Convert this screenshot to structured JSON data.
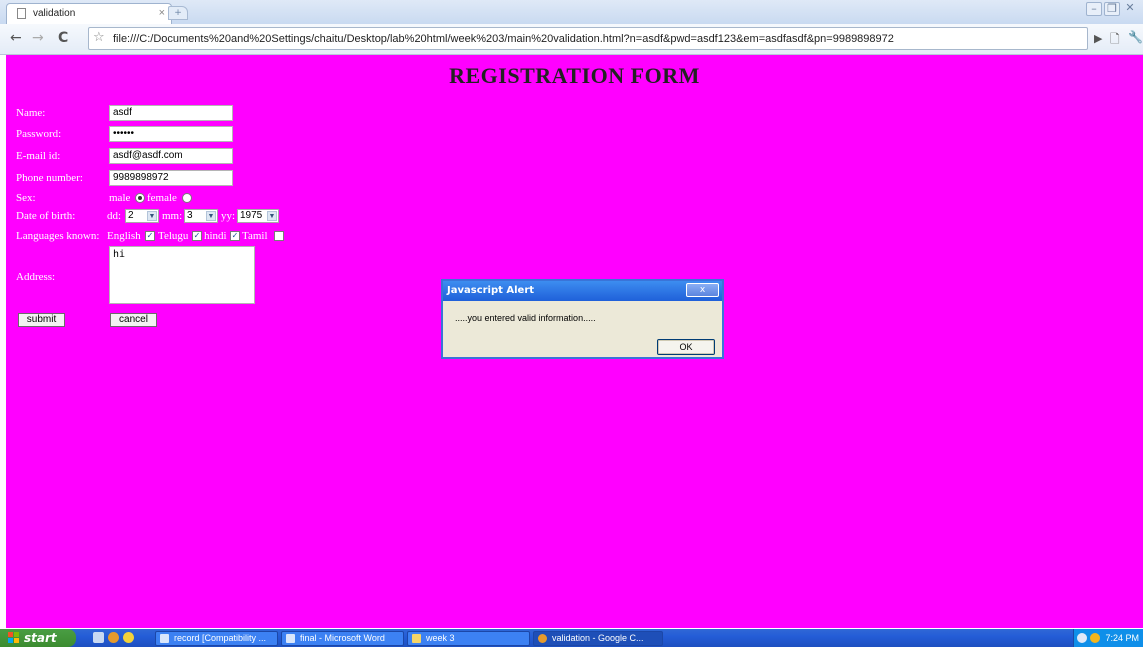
{
  "browser": {
    "tab_title": "validation",
    "tab_close": "×",
    "url": "file:///C:/Documents%20and%20Settings/chaitu/Desktop/lab%20html/week%203/main%20validation.html?n=asdf&pwd=asdf123&em=asdfasdf&pn=9989898972",
    "icons": {
      "back": "back-arrow-icon",
      "forward": "forward-arrow-icon",
      "reload": "reload-icon",
      "star": "star-icon",
      "page": "page-menu-icon",
      "wrench": "wrench-icon"
    }
  },
  "form": {
    "heading": "REGISTRATION FORM",
    "name_label": "Name:",
    "name_value": "asdf",
    "password_label": "Password:",
    "password_value": "••••••",
    "email_label": "E-mail id:",
    "email_value": "asdf@asdf.com",
    "phone_label": "Phone number:",
    "phone_value": "9989898972",
    "sex_label": "Sex:",
    "sex_male": "male",
    "sex_female": "female",
    "dob_label": "Date of birth:",
    "dd_label": "dd:",
    "dd_value": "2",
    "mm_label": "mm:",
    "mm_value": "3",
    "yy_label": "yy:",
    "yy_value": "1975",
    "lang_label": "Languages known:",
    "lang_english": "English",
    "lang_telugu": "Telugu",
    "lang_hindi": "hindi",
    "lang_tamil": "Tamil",
    "address_label": "Address:",
    "address_value": "hi",
    "submit_label": "submit",
    "cancel_label": "cancel"
  },
  "alert": {
    "title": "Javascript Alert",
    "close": "x",
    "message": ".....you entered valid information.....",
    "ok_label": "OK"
  },
  "taskbar": {
    "start_label": "start",
    "tasks": [
      "record [Compatibility ...",
      "final - Microsoft Word",
      "week 3",
      "validation - Google C..."
    ],
    "clock": "7:24 PM"
  },
  "colors": {
    "page_bg": "#ff00ff",
    "taskbar": "#245dd7",
    "start": "#3b8c2f",
    "alert_title": "#1f60d9"
  }
}
